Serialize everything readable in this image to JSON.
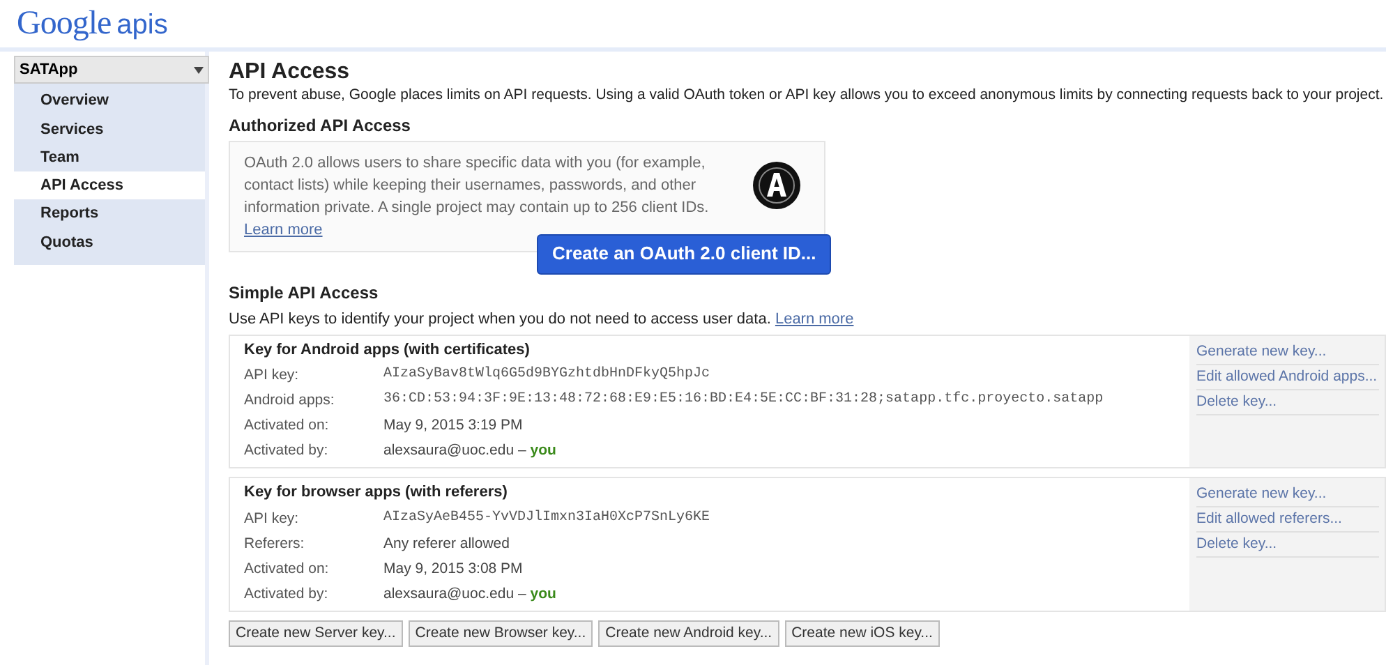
{
  "logo": {
    "brand": "Google",
    "product": "apis"
  },
  "project_select": {
    "value": "SATApp"
  },
  "sidebar": {
    "items": [
      {
        "label": "Overview",
        "selected": false
      },
      {
        "label": "Services",
        "selected": false
      },
      {
        "label": "Team",
        "selected": false
      },
      {
        "label": "API Access",
        "selected": true
      },
      {
        "label": "Reports",
        "selected": false
      },
      {
        "label": "Quotas",
        "selected": false
      }
    ]
  },
  "title": "API Access",
  "intro": "To prevent abuse, Google places limits on API requests. Using a valid OAuth token or API key allows you to exceed anonymous limits by connecting requests back to your project.",
  "authorized": {
    "heading": "Authorized API Access",
    "text": "OAuth 2.0 allows users to share specific data with you (for example, contact lists) while keeping their usernames, passwords, and other information private. A single project may contain up to 256 client IDs.",
    "link": "Learn more",
    "button": "Create an OAuth 2.0 client ID..."
  },
  "simple": {
    "heading": "Simple API Access",
    "text": "Use API keys to identify your project when you do not need to access user data.",
    "link": "Learn more"
  },
  "keys": [
    {
      "title": "Key for Android apps (with certificates)",
      "rows": [
        {
          "kind": "mono",
          "label": "API key:",
          "value": "AIzaSyBav8tWlq6G5d9BYGzhtdbHnDFkyQ5hpJc"
        },
        {
          "kind": "mono",
          "label": "Android apps:",
          "value": "36:CD:53:94:3F:9E:13:48:72:68:E9:E5:16:BD:E4:5E:CC:BF:31:28;satapp.tfc.proyecto.satapp"
        },
        {
          "kind": "text",
          "label": "Activated on:",
          "value": "May 9, 2015 3:19 PM"
        },
        {
          "kind": "owner",
          "label": "Activated by:",
          "value": "alexsaura@uoc.edu –",
          "tag": "you"
        }
      ],
      "actions": [
        "Generate new key...",
        "Edit allowed Android apps...",
        "Delete key..."
      ]
    },
    {
      "title": "Key for browser apps (with referers)",
      "rows": [
        {
          "kind": "mono",
          "label": "API key:",
          "value": "AIzaSyAeB455-YvVDJlImxn3IaH0XcP7SnLy6KE"
        },
        {
          "kind": "text",
          "label": "Referers:",
          "value": "Any referer allowed"
        },
        {
          "kind": "text",
          "label": "Activated on:",
          "value": "May 9, 2015 3:08 PM"
        },
        {
          "kind": "owner",
          "label": "Activated by:",
          "value": "alexsaura@uoc.edu –",
          "tag": "you"
        }
      ],
      "actions": [
        "Generate new key...",
        "Edit allowed referers...",
        "Delete key..."
      ]
    }
  ],
  "buttons": [
    "Create new Server key...",
    "Create new Browser key...",
    "Create new Android key...",
    "Create new iOS key..."
  ]
}
